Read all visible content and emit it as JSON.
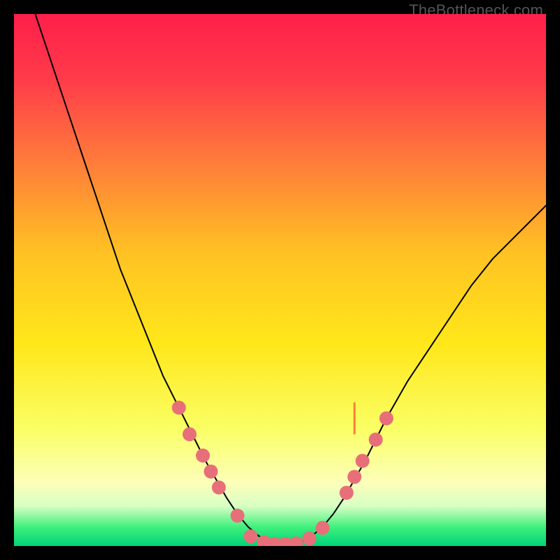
{
  "watermark": "TheBottleneck.com",
  "chart_data": {
    "type": "line",
    "title": "",
    "xlabel": "",
    "ylabel": "",
    "xlim": [
      0,
      100
    ],
    "ylim": [
      0,
      100
    ],
    "background_gradient": {
      "stops": [
        {
          "offset": 0.0,
          "color": "#ff1f4a"
        },
        {
          "offset": 0.12,
          "color": "#ff3a4a"
        },
        {
          "offset": 0.28,
          "color": "#ff7d3a"
        },
        {
          "offset": 0.45,
          "color": "#ffc223"
        },
        {
          "offset": 0.62,
          "color": "#ffe71a"
        },
        {
          "offset": 0.78,
          "color": "#faff65"
        },
        {
          "offset": 0.88,
          "color": "#fdffb8"
        },
        {
          "offset": 0.925,
          "color": "#d8ffc4"
        },
        {
          "offset": 0.965,
          "color": "#3df07a"
        },
        {
          "offset": 1.0,
          "color": "#00d37a"
        }
      ]
    },
    "series": [
      {
        "name": "bottleneck-curve",
        "color": "#000000",
        "stroke_width": 2,
        "x": [
          4,
          6,
          8,
          10,
          12,
          14,
          16,
          18,
          20,
          22,
          24,
          26,
          28,
          30,
          32,
          34,
          36,
          38,
          40,
          42,
          44,
          46,
          48,
          50,
          52,
          54,
          56,
          58,
          60,
          62,
          64,
          66,
          68,
          70,
          74,
          78,
          82,
          86,
          90,
          94,
          98,
          100
        ],
        "y": [
          100,
          94,
          88,
          82,
          76,
          70,
          64,
          58,
          52,
          47,
          42,
          37,
          32,
          28,
          24,
          20,
          16,
          12.5,
          9,
          6,
          3.6,
          1.9,
          0.8,
          0.3,
          0.3,
          0.8,
          1.9,
          3.6,
          6,
          9,
          12.5,
          16,
          20,
          24,
          31,
          37,
          43,
          49,
          54,
          58,
          62,
          64
        ]
      }
    ],
    "markers": {
      "name": "curve-dots",
      "color": "#e76f7a",
      "radius": 10,
      "points": [
        {
          "x": 31,
          "y": 26
        },
        {
          "x": 33,
          "y": 21
        },
        {
          "x": 35.5,
          "y": 17
        },
        {
          "x": 37,
          "y": 14
        },
        {
          "x": 38.5,
          "y": 11
        },
        {
          "x": 42,
          "y": 5.7
        },
        {
          "x": 44.5,
          "y": 1.8
        },
        {
          "x": 47,
          "y": 0.7
        },
        {
          "x": 49,
          "y": 0.4
        },
        {
          "x": 51,
          "y": 0.4
        },
        {
          "x": 53,
          "y": 0.5
        },
        {
          "x": 55.5,
          "y": 1.4
        },
        {
          "x": 58,
          "y": 3.4
        },
        {
          "x": 62.5,
          "y": 10
        },
        {
          "x": 64,
          "y": 13
        },
        {
          "x": 65.5,
          "y": 16
        },
        {
          "x": 68,
          "y": 20
        },
        {
          "x": 70,
          "y": 24
        }
      ]
    },
    "notch": {
      "x": 64,
      "y_from": 21,
      "y_to": 27,
      "color": "#ff7d3a"
    }
  }
}
